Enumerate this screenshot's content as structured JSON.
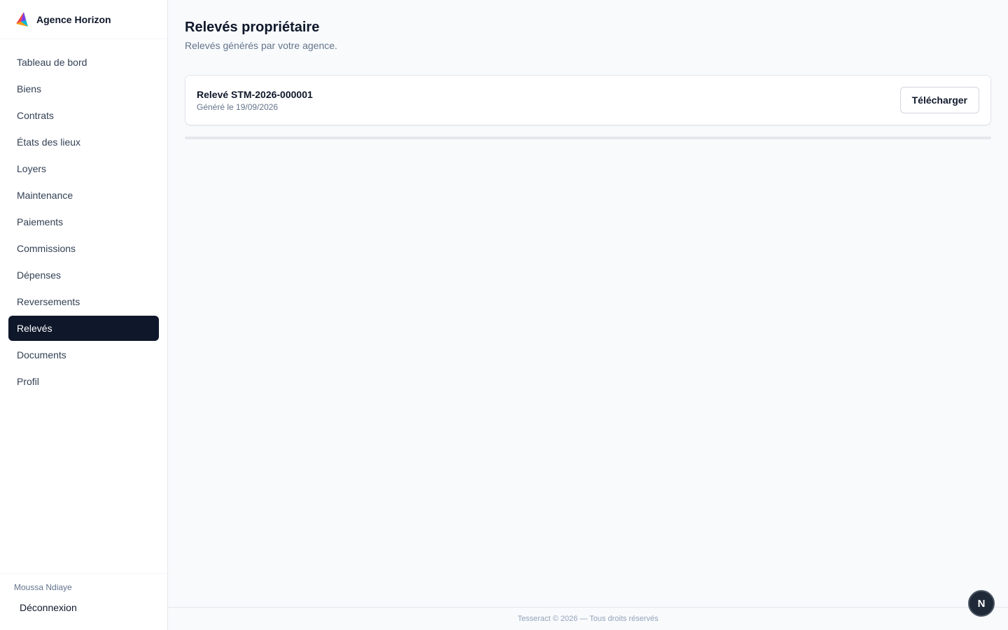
{
  "brand": {
    "name": "Agence Horizon",
    "logo_icon": "triangle-logo-icon"
  },
  "sidebar": {
    "items": [
      {
        "label": "Tableau de bord",
        "active": false
      },
      {
        "label": "Biens",
        "active": false
      },
      {
        "label": "Contrats",
        "active": false
      },
      {
        "label": "États des lieux",
        "active": false
      },
      {
        "label": "Loyers",
        "active": false
      },
      {
        "label": "Maintenance",
        "active": false
      },
      {
        "label": "Paiements",
        "active": false
      },
      {
        "label": "Commissions",
        "active": false
      },
      {
        "label": "Dépenses",
        "active": false
      },
      {
        "label": "Reversements",
        "active": false
      },
      {
        "label": "Relevés",
        "active": true
      },
      {
        "label": "Documents",
        "active": false
      },
      {
        "label": "Profil",
        "active": false
      }
    ],
    "user_name": "Moussa Ndiaye",
    "logout_label": "Déconnexion"
  },
  "main": {
    "title": "Relevés propriétaire",
    "subtitle": "Relevés générés par votre agence.",
    "statements": [
      {
        "title": "Relevé STM-2026-000001",
        "generated": "Généré le 19/09/2026",
        "download_label": "Télécharger"
      }
    ]
  },
  "footer": {
    "text": "Tesseract © 2026 — Tous droits réservés"
  },
  "fab": {
    "label": "N"
  },
  "colors": {
    "active_bg": "#0f172a",
    "background": "#f8fafc",
    "sidebar_bg": "#ffffff",
    "muted_text": "#64748b"
  }
}
